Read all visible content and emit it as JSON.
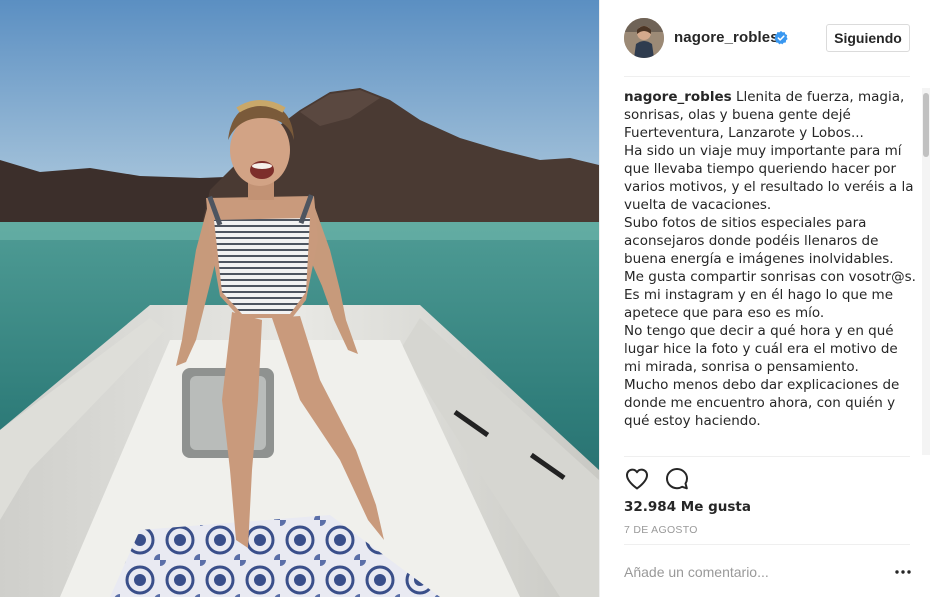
{
  "post": {
    "image_alt": "Mujer en bañador de rayas de pie en la proa de una lancha neumática, con el mar y una montaña volcánica al fondo",
    "author": {
      "username": "nagore_robles",
      "verified": true,
      "avatar_icon": "profile-photo"
    },
    "follow_button_label": "Siguiendo",
    "caption": {
      "username": "nagore_robles",
      "text": "Llenita de fuerza, magia, sonrisas, olas y buena gente dejé Fuerteventura, Lanzarote y Lobos...\nHa sido un viaje muy importante para mí que llevaba tiempo queriendo hacer por varios motivos, y el resultado lo veréis a la vuelta de vacaciones.\nSubo fotos de sitios especiales para aconsejaros donde podéis llenaros de buena energía e imágenes inolvidables.\nMe gusta compartir sonrisas con vosotr@s.\nEs mi instagram y en él hago lo que me apetece que para eso es mío.\nNo tengo que decir a qué hora y en qué lugar hice la foto y cuál era el motivo de mi mirada, sonrisa o pensamiento.\nMucho menos debo dar explicaciones de donde me encuentro ahora, con quién y qué estoy haciendo."
    },
    "actions": {
      "like_icon": "heart-icon",
      "comment_icon": "comment-icon"
    },
    "likes_text": "32.984 Me gusta",
    "date_text": "7 DE AGOSTO",
    "comment_placeholder": "Añade un comentario...",
    "more_icon": "more-options-icon"
  },
  "colors": {
    "verified_badge": "#3897f0",
    "text": "#262626",
    "muted": "#999999",
    "border": "#dbdbdb"
  }
}
